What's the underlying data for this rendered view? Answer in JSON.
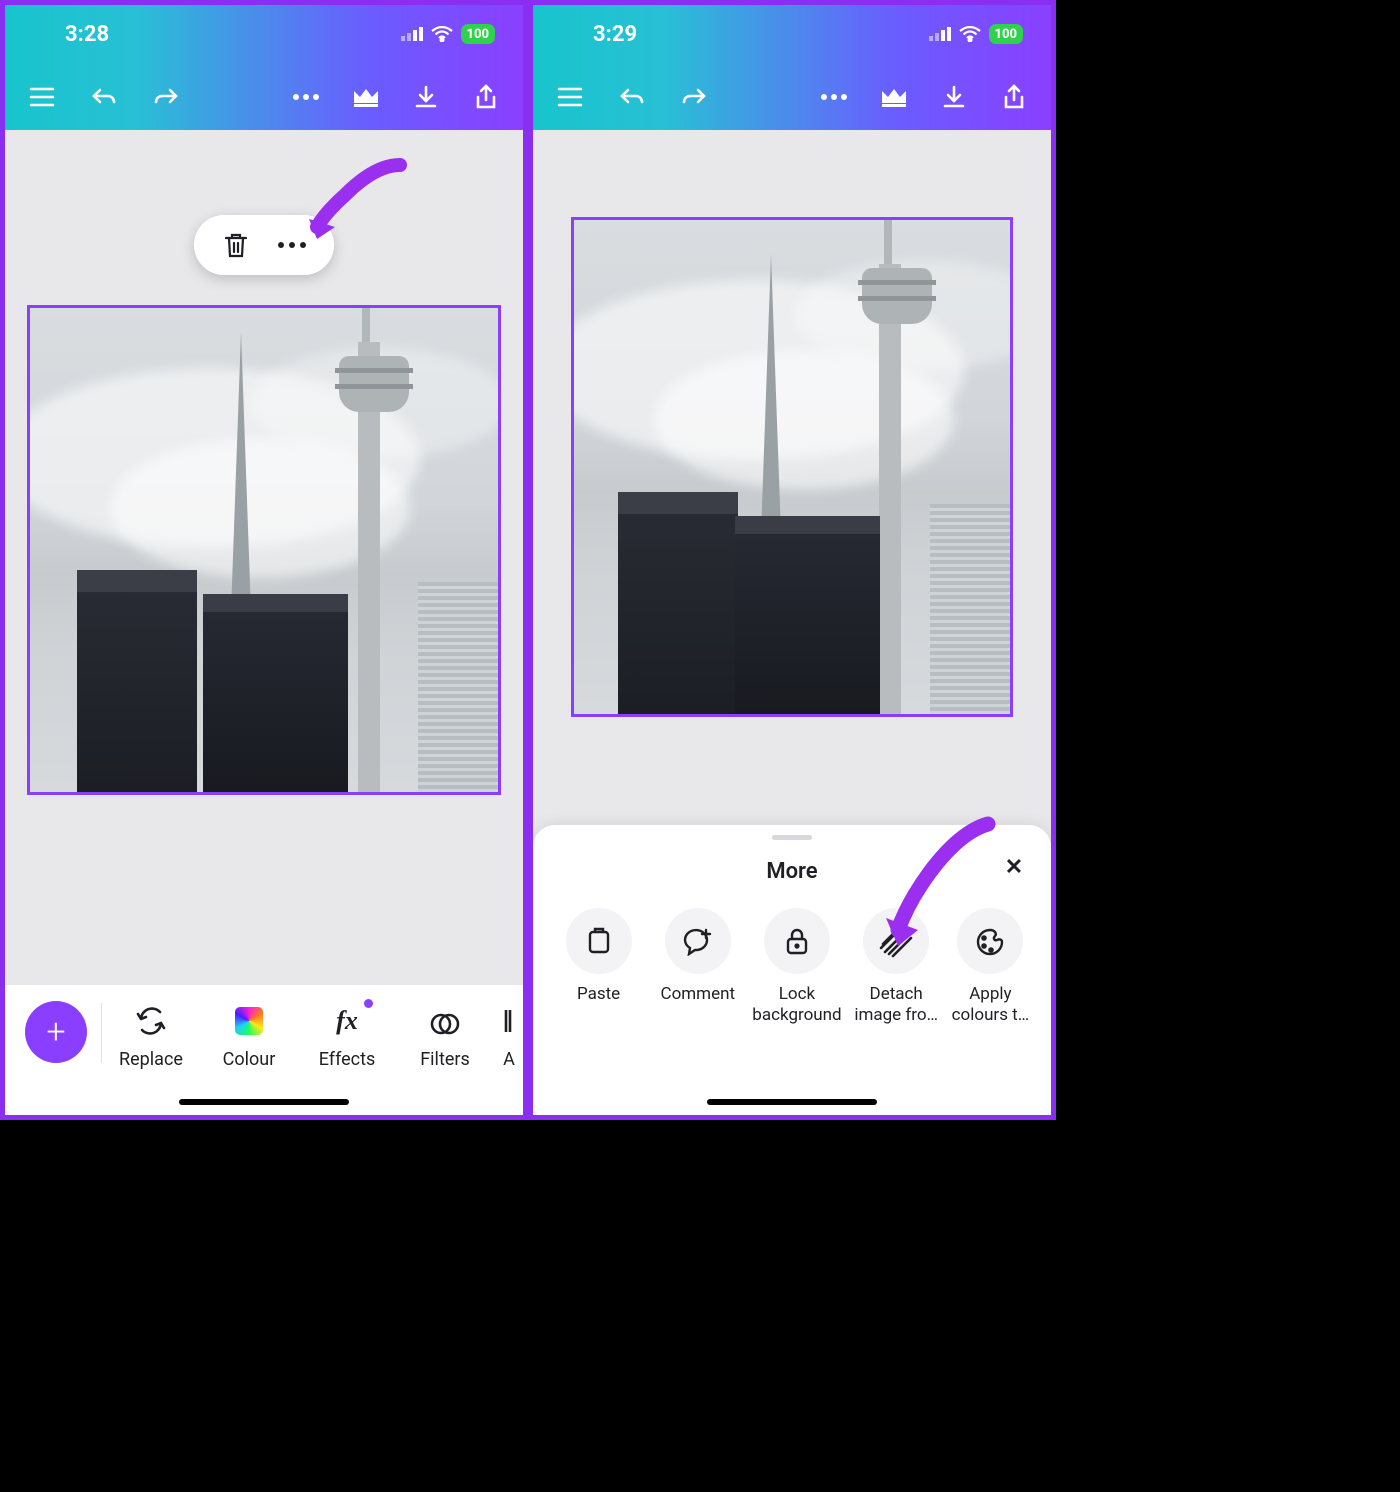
{
  "left": {
    "status": {
      "time": "3:28",
      "battery": "100"
    },
    "toolbar": {
      "replace": "Replace",
      "colour": "Colour",
      "effects": "Effects",
      "filters": "Filters",
      "partial_next": "A"
    }
  },
  "right": {
    "status": {
      "time": "3:29",
      "battery": "100"
    },
    "sheet": {
      "title": "More",
      "items": [
        {
          "label": "Paste"
        },
        {
          "label": "Comment"
        },
        {
          "label": "Lock background"
        },
        {
          "label": "Detach image fro…"
        },
        {
          "label": "Apply colours t…"
        }
      ]
    }
  }
}
